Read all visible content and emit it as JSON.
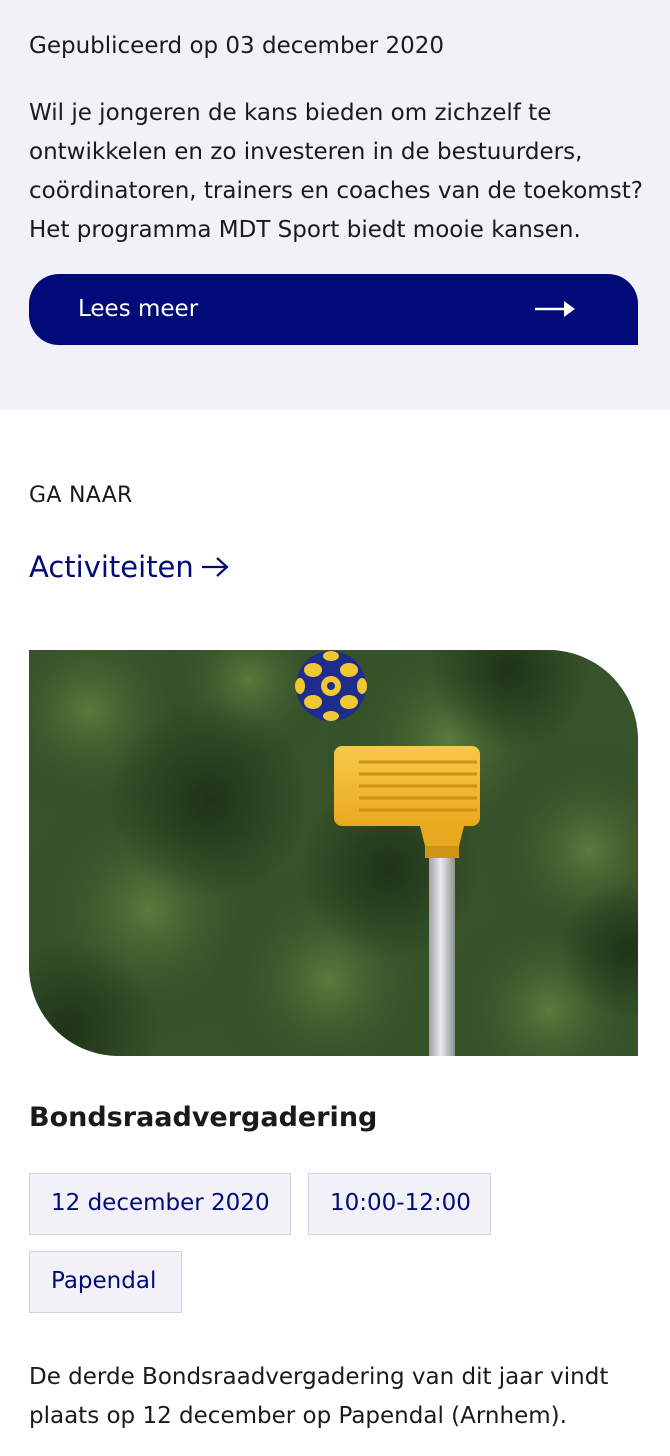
{
  "news": {
    "published": "Gepubliceerd op 03 december 2020",
    "text": "Wil je jongeren de kans bieden om zichzelf te ontwikkelen en zo investeren in de bestuurders, coördinatoren, trainers en coaches van de toekomst? Het programma MDT Sport biedt mooie kansen.",
    "read_more_label": "Lees meer"
  },
  "goto": {
    "label": "GA NAAR",
    "link_text": "Activiteiten"
  },
  "event": {
    "title": "Bondsraadvergadering",
    "date": "12 december 2020",
    "time": "10:00-12:00",
    "location": "Papendal",
    "description": "De derde Bondsraadvergadering van dit jaar vindt plaats op 12 december op Papendal (Arnhem)."
  },
  "icons": {
    "read_more": "arrow-right-icon",
    "goto": "arrow-right-icon"
  },
  "colors": {
    "accent": "#000a78",
    "panel": "#f1f1f7",
    "tag_border": "#d2d2dc"
  }
}
